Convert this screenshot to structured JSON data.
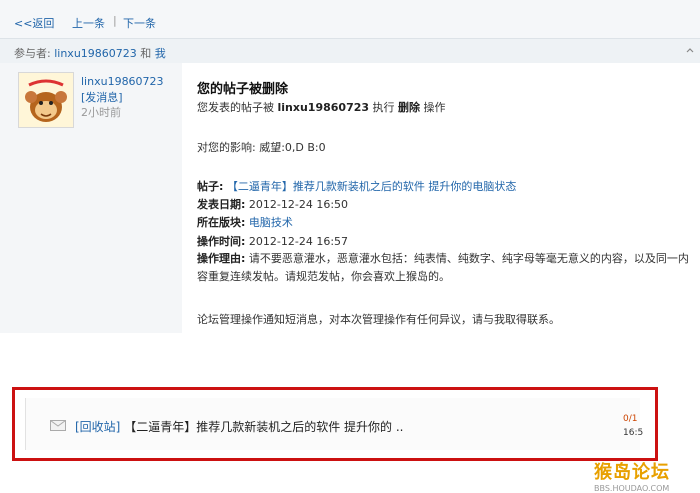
{
  "nav": {
    "back": "<<返回",
    "prev": "上一条",
    "sep": "|",
    "next": "下一条"
  },
  "participants": {
    "label": "参与者:",
    "user": "linxu19860723",
    "and": "和",
    "me": "我"
  },
  "sender": {
    "name": "linxu19860723",
    "send_message": "[发消息]",
    "time_ago": "2小时前"
  },
  "message": {
    "title": "您的帖子被删除",
    "line1_pre": "您发表的帖子被",
    "line1_user": "linxu19860723",
    "line1_mid": "执行",
    "line1_action": "删除",
    "line1_post": "操作",
    "impact": "对您的影响: 威望:0,D B:0",
    "post_label": "帖子:",
    "post_title": "【二逼青年】推荐几款新装机之后的软件 提升你的电脑状态",
    "date_label": "发表日期:",
    "date": "2012-12-24 16:50",
    "board_label": "所在版块:",
    "board": "电脑技术",
    "op_time_label": "操作时间:",
    "op_time": "2012-12-24 16:57",
    "reason_label": "操作理由:",
    "reason": "请不要恶意灌水，恶意灌水包括：纯表情、纯数字、纯字母等毫无意义的内容，以及同一内容重复连续发帖。请规范发帖，你会喜欢上猴岛的。",
    "footer": "论坛管理操作通知短消息，对本次管理操作有任何异议，请与我取得联系。"
  },
  "list_item": {
    "tag": "[回收站]",
    "text": "【二逼青年】推荐几款新装机之后的软件 提升你的 ..",
    "count": "0/1",
    "time": "16:5"
  },
  "watermark": {
    "title": "猴岛论坛",
    "url": "BBS.HOUDAO.COM"
  },
  "colors": {
    "link": "#2266aa",
    "highlight_border": "#cc1111"
  }
}
